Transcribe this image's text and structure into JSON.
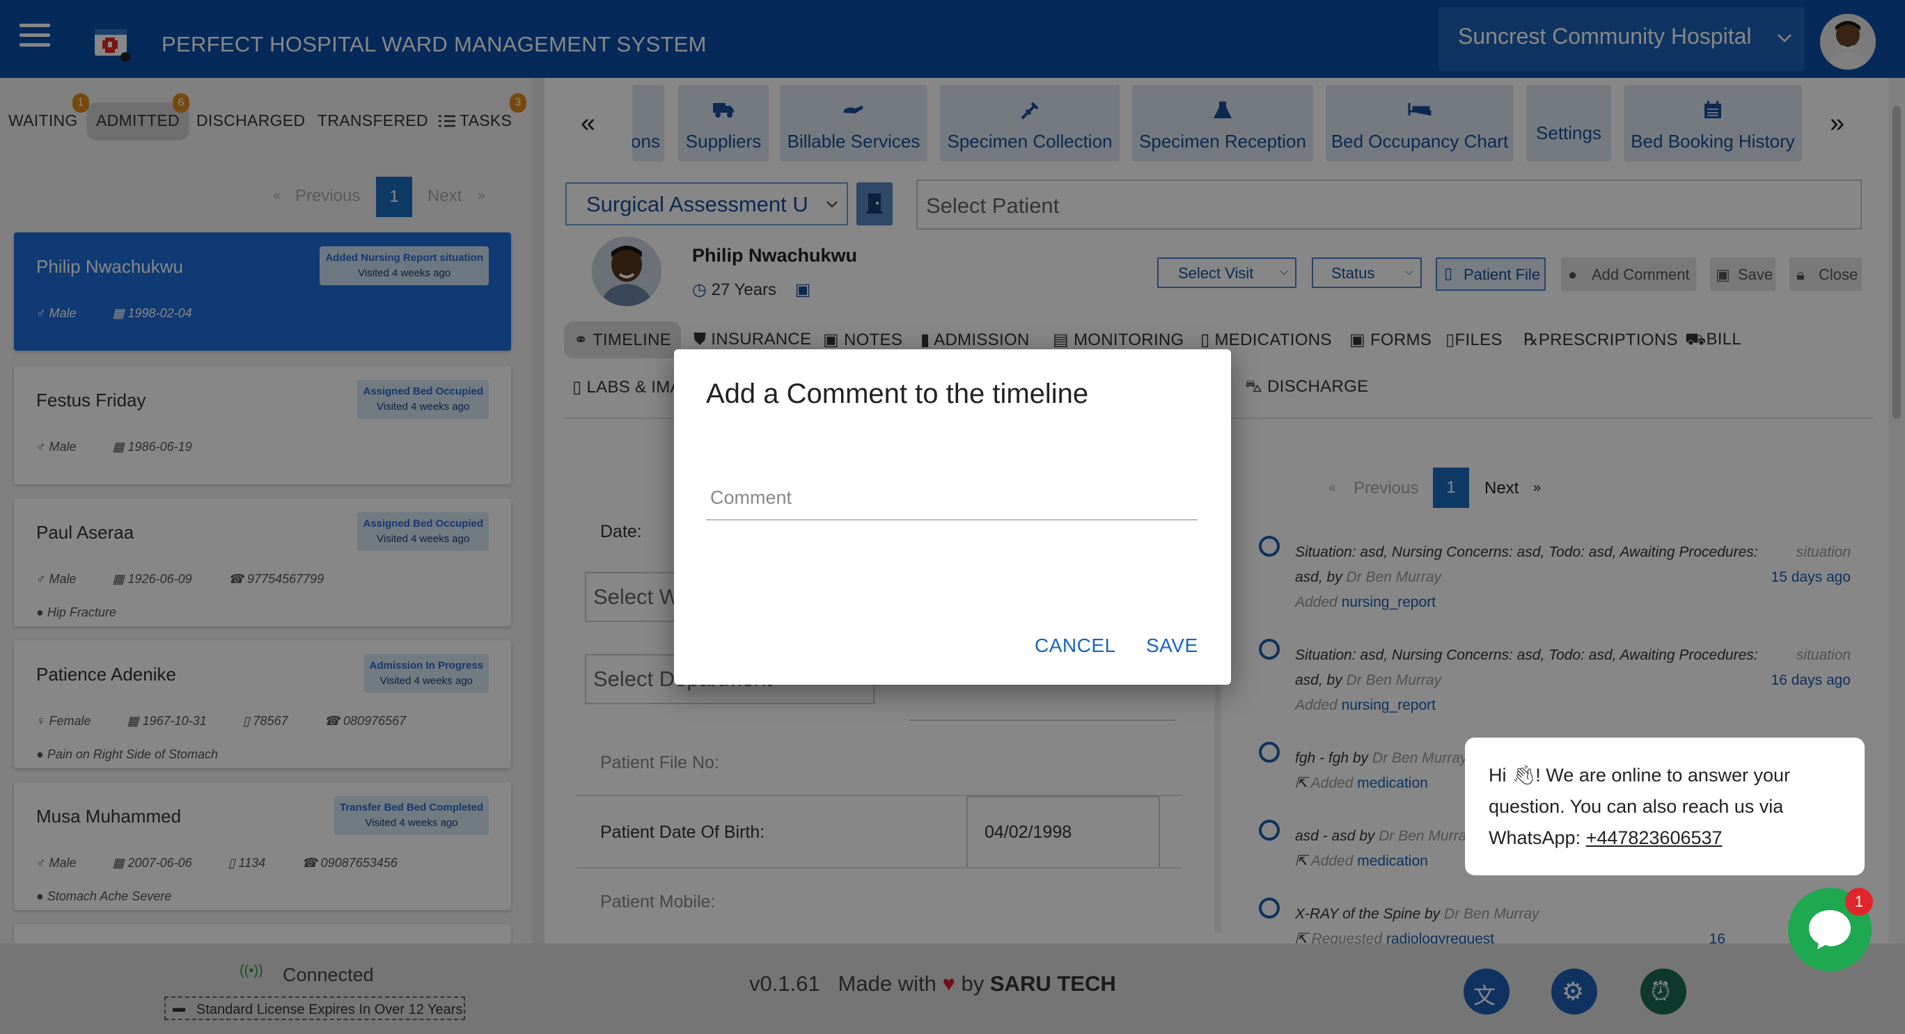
{
  "header": {
    "title": "PERFECT HOSPITAL WARD MANAGEMENT SYSTEM",
    "hospital": "Suncrest Community Hospital"
  },
  "left_tabs": [
    {
      "label": "WAITING",
      "badge": "1"
    },
    {
      "label": "ADMITTED",
      "badge": "6"
    },
    {
      "label": "DISCHARGED"
    },
    {
      "label": "TRANSFERED"
    },
    {
      "label": "TASKS",
      "badge": "3"
    }
  ],
  "pager_left": {
    "prev": "Previous",
    "page": "1",
    "next": "Next",
    "prev_sym": "«",
    "next_sym": "»"
  },
  "patients": [
    {
      "name": "Philip Nwachukwu",
      "status": "Added Nursing Report situation",
      "visited": "Visited 4 weeks ago",
      "gender": "Male",
      "dob": "1998-02-04"
    },
    {
      "name": "Festus Friday",
      "status": "Assigned Bed Occupied",
      "visited": "Visited 4 weeks ago",
      "gender": "Male",
      "dob": "1986-06-19"
    },
    {
      "name": "Paul Aseraa",
      "status": "Assigned Bed Occupied",
      "visited": "Visited 4 weeks ago",
      "gender": "Male",
      "dob": "1926-06-09",
      "phone": "97754567799",
      "condition": "Hip Fracture"
    },
    {
      "name": "Patience Adenike",
      "status": "Admission In Progress",
      "visited": "Visited 4 weeks ago",
      "gender": "Female",
      "dob": "1967-10-31",
      "file": "78567",
      "phone": "080976567",
      "condition": "Pain on Right Side of Stomach"
    },
    {
      "name": "Musa Muhammed",
      "status": "Transfer Bed Bed Completed",
      "visited": "Visited 4 weeks ago",
      "gender": "Male",
      "dob": "2007-06-06",
      "file": "1134",
      "phone": "09087653456",
      "condition": "Stomach Ache Severe"
    }
  ],
  "connection": {
    "status": "Connected",
    "license": "Standard License Expires In Over 12 Years"
  },
  "top_toolbar": [
    "ons",
    "Suppliers",
    "Billable Services",
    "Specimen Collection",
    "Specimen Reception",
    "Bed Occupancy Chart",
    "Settings",
    "Bed Booking History"
  ],
  "arrows": {
    "left": "«",
    "right": "»"
  },
  "unit_select": "Surgical Assessment U",
  "patient_select_placeholder": "Select  Patient",
  "current_patient": {
    "name": "Philip Nwachukwu",
    "age": "27 Years"
  },
  "patient_controls": {
    "visit": "Select Visit",
    "status": "Status",
    "file": "Patient File",
    "comment": "Add Comment",
    "save": "Save",
    "close": "Close"
  },
  "patient_tabs": [
    "TIMELINE",
    "INSURANCE",
    "NOTES",
    "ADMISSION",
    "MONITORING",
    "MEDICATIONS",
    "FORMS",
    "FILES",
    "PRESCRIPTIONS",
    "BILL",
    "LABS & IMA",
    "DISCHARGE"
  ],
  "form": {
    "date_label": "Date:",
    "select_ward": "Select  W",
    "select_department": "Select  Department",
    "file_no_label": "Patient File No:",
    "dob_label": "Patient Date Of Birth:",
    "dob_value": "04/02/1998",
    "mobile_label": "Patient Mobile:"
  },
  "timeline_pager": {
    "prev": "Previous",
    "page": "1",
    "next": "Next",
    "prev_sym": "«",
    "next_sym": "»"
  },
  "timeline": [
    {
      "text": "Situation: asd, Nursing Concerns: asd, Todo: asd, Awaiting Procedures: asd, by",
      "doctor": "Dr Ben Murray",
      "action": "Added",
      "link": "nursing_report",
      "type": "situation",
      "ago": "15 days ago"
    },
    {
      "text": "Situation: asd, Nursing Concerns: asd, Todo: asd, Awaiting Procedures: asd, by",
      "doctor": "Dr Ben Murray",
      "action": "Added",
      "link": "nursing_report",
      "type": "situation",
      "ago": "16 days ago"
    },
    {
      "text": "fgh - fgh by",
      "doctor": "Dr Ben Murray",
      "action": "Added",
      "link": "medication"
    },
    {
      "text": "asd - asd by",
      "doctor": "Dr Ben Murra",
      "action": "Added",
      "link": "medication"
    },
    {
      "text": "X-RAY of the Spine by",
      "doctor": "Dr Ben Murray",
      "action": "Requested",
      "link": "radiologyrequest",
      "ago": "16"
    }
  ],
  "footer": {
    "version": "v0.1.61",
    "made_with": "Made with",
    "by": "by",
    "brand": "SARU TECH"
  },
  "modal": {
    "title": "Add a Comment to the timeline",
    "comment_placeholder": "Comment",
    "cancel": "CANCEL",
    "save": "SAVE"
  },
  "chat": {
    "greeting": "Hi",
    "message": "! We are online to answer your question. You can also reach us via WhatsApp: ",
    "phone": "+447823606537",
    "badge": "1"
  },
  "colors": {
    "primary": "#0b4fa8",
    "accent": "#1e6fd9",
    "chat": "#1ea84f",
    "badge": "#e08a1c"
  }
}
